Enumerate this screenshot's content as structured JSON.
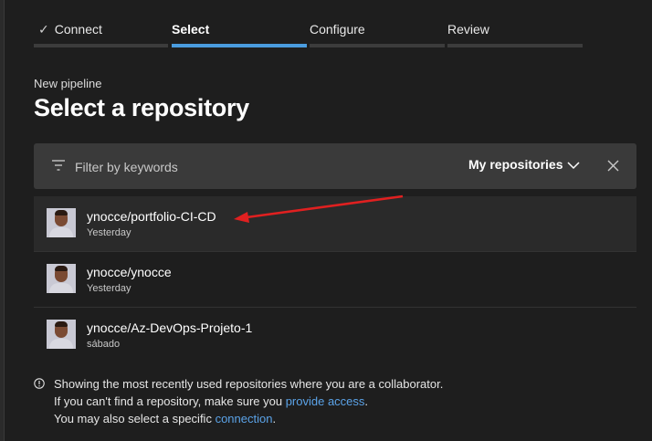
{
  "wizard": {
    "steps": [
      {
        "label": "Connect"
      },
      {
        "label": "Select"
      },
      {
        "label": "Configure"
      },
      {
        "label": "Review"
      }
    ],
    "active_step": "Select"
  },
  "header": {
    "subtitle": "New pipeline",
    "title": "Select a repository"
  },
  "filter": {
    "placeholder": "Filter by keywords",
    "value": "",
    "scope_label": "My repositories",
    "icons": {
      "filter": "filter-icon",
      "dropdown": "chevron-down-icon",
      "clear": "close-icon"
    }
  },
  "repositories": [
    {
      "name": "ynocce/portfolio-CI-CD",
      "updated": "Yesterday",
      "selected": true
    },
    {
      "name": "ynocce/ynocce",
      "updated": "Yesterday",
      "selected": false
    },
    {
      "name": "ynocce/Az-DevOps-Projeto-1",
      "updated": "sábado",
      "selected": false
    }
  ],
  "info": {
    "line1": "Showing the most recently used repositories where you are a collaborator.",
    "line2_prefix": "If you can't find a repository, make sure you ",
    "line2_link": "provide access",
    "line2_suffix": ".",
    "line3_prefix": "You may also select a specific ",
    "line3_link": "connection",
    "line3_suffix": "."
  },
  "colors": {
    "background": "#1e1e1e",
    "accent": "#4a9cdf",
    "link": "#5ba3e8",
    "annotation_arrow": "#e02020"
  }
}
